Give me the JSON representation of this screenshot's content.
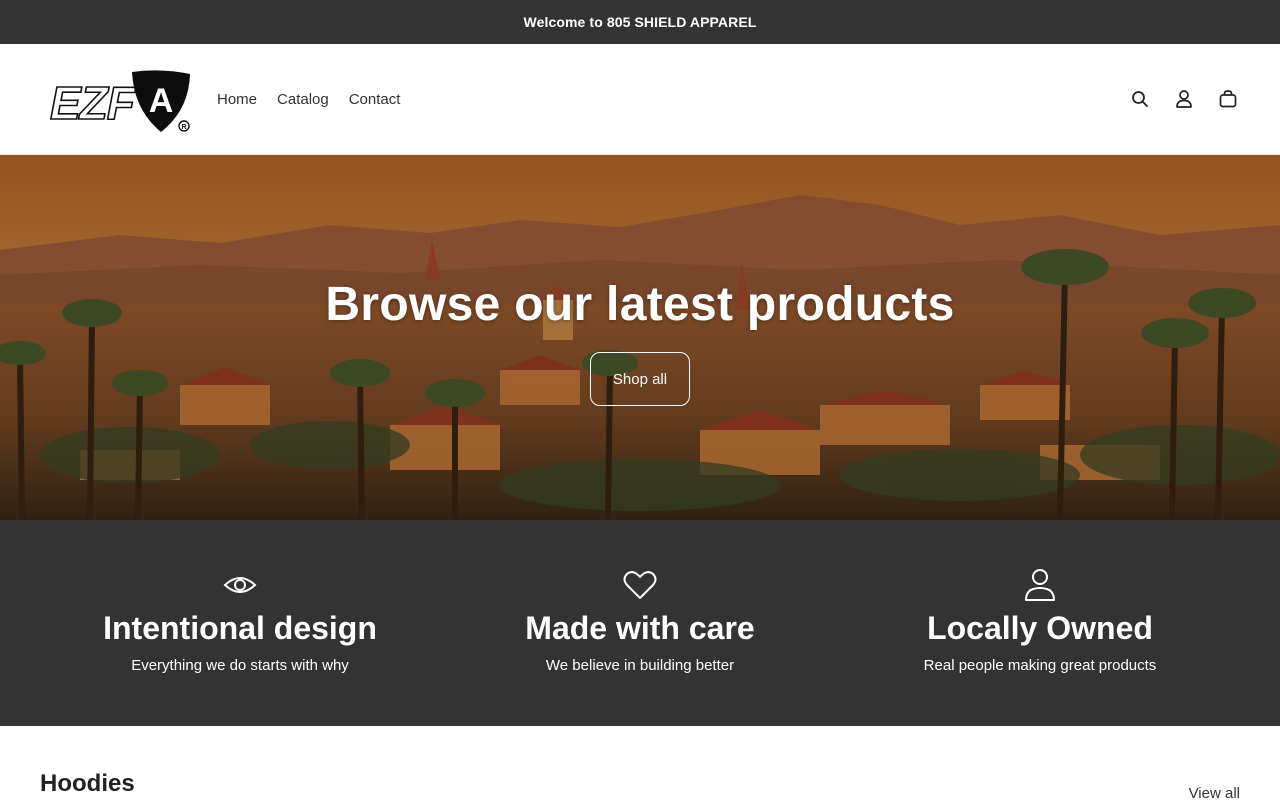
{
  "announcement": {
    "text": "Welcome to 805 SHIELD APPAREL"
  },
  "header": {
    "logo_text": "EZF",
    "logo_badge_letter": "A",
    "nav": [
      {
        "label": "Home"
      },
      {
        "label": "Catalog"
      },
      {
        "label": "Contact"
      }
    ],
    "icons": [
      "search-icon",
      "account-icon",
      "cart-icon"
    ]
  },
  "hero": {
    "title": "Browse our latest products",
    "button_label": "Shop all"
  },
  "features": [
    {
      "icon": "eye-icon",
      "title": "Intentional design",
      "text": "Everything we do starts with why"
    },
    {
      "icon": "heart-icon",
      "title": "Made with care",
      "text": "We believe in building better"
    },
    {
      "icon": "person-icon",
      "title": "Locally Owned",
      "text": "Real people making great products"
    }
  ],
  "collection": {
    "title": "Hoodies",
    "view_all_label": "View all"
  },
  "colors": {
    "dark_band": "#333333",
    "accent_white": "#ffffff"
  }
}
